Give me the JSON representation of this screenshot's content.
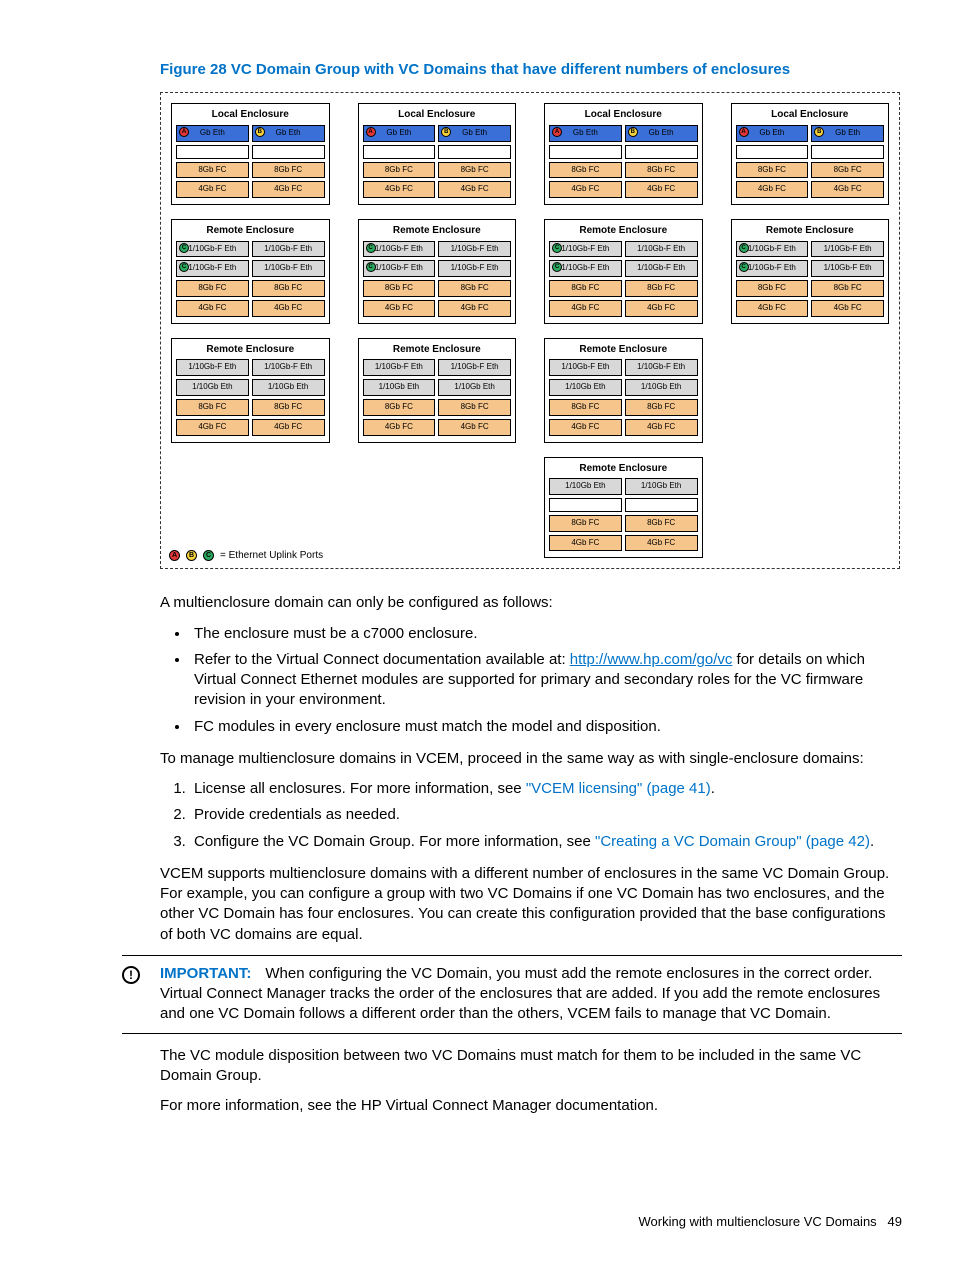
{
  "figure": {
    "title": "Figure 28 VC Domain Group with VC Domains that have different numbers of enclosures",
    "legend_text": "= Ethernet Uplink Ports",
    "port_labels": {
      "a": "A",
      "b": "B",
      "c": "C"
    },
    "enclosure_labels": {
      "local": "Local Enclosure",
      "remote": "Remote Enclosure"
    },
    "modules": {
      "gb_eth": "Gb Eth",
      "ten_gbf_eth": "1/10Gb-F Eth",
      "ten_gb_eth": "1/10Gb Eth",
      "fc8": "8Gb FC",
      "fc4": "4Gb FC",
      "fc8r": "8Gb FC",
      "fc4r": "4Gb FC"
    }
  },
  "body": {
    "p1": "A multienclosure domain can only be configured as follows:",
    "bullets": [
      "The enclosure must be a c7000 enclosure.",
      "Refer to the Virtual Connect documentation available at: ",
      "FC modules in every enclosure must match the model and disposition."
    ],
    "bullet2_link_text": "http://www.hp.com/go/vc",
    "bullet2_tail": " for details on which Virtual Connect Ethernet modules are supported for primary and secondary roles for the VC firmware revision in your environment.",
    "p2": "To manage multienclosure domains in VCEM, proceed in the same way as with single-enclosure domains:",
    "steps": {
      "s1_a": "License all enclosures. For more information, see ",
      "s1_link": "\"VCEM licensing\" (page 41)",
      "s1_b": ".",
      "s2": "Provide credentials as needed.",
      "s3_a": "Configure the VC Domain Group. For more information, see ",
      "s3_link": "\"Creating a VC Domain Group\" (page 42)",
      "s3_b": "."
    },
    "p3": "VCEM supports multienclosure domains with a different number of enclosures in the same VC Domain Group. For example, you can configure a group with two VC Domains if one VC Domain has two enclosures, and the other VC Domain has four enclosures. You can create this configuration provided that the base configurations of both VC domains are equal.",
    "important_label": "IMPORTANT:",
    "important_text": "When configuring the VC Domain, you must add the remote enclosures in the correct order. Virtual Connect Manager tracks the order of the enclosures that are added. If you add the remote enclosures and one VC Domain follows a different order than the others, VCEM fails to manage that VC Domain.",
    "p4": "The VC module disposition between two VC Domains must match for them to be included in the same VC Domain Group.",
    "p5": "For more information, see the HP Virtual Connect Manager documentation."
  },
  "footer": {
    "section": "Working with multienclosure VC Domains",
    "page": "49"
  }
}
